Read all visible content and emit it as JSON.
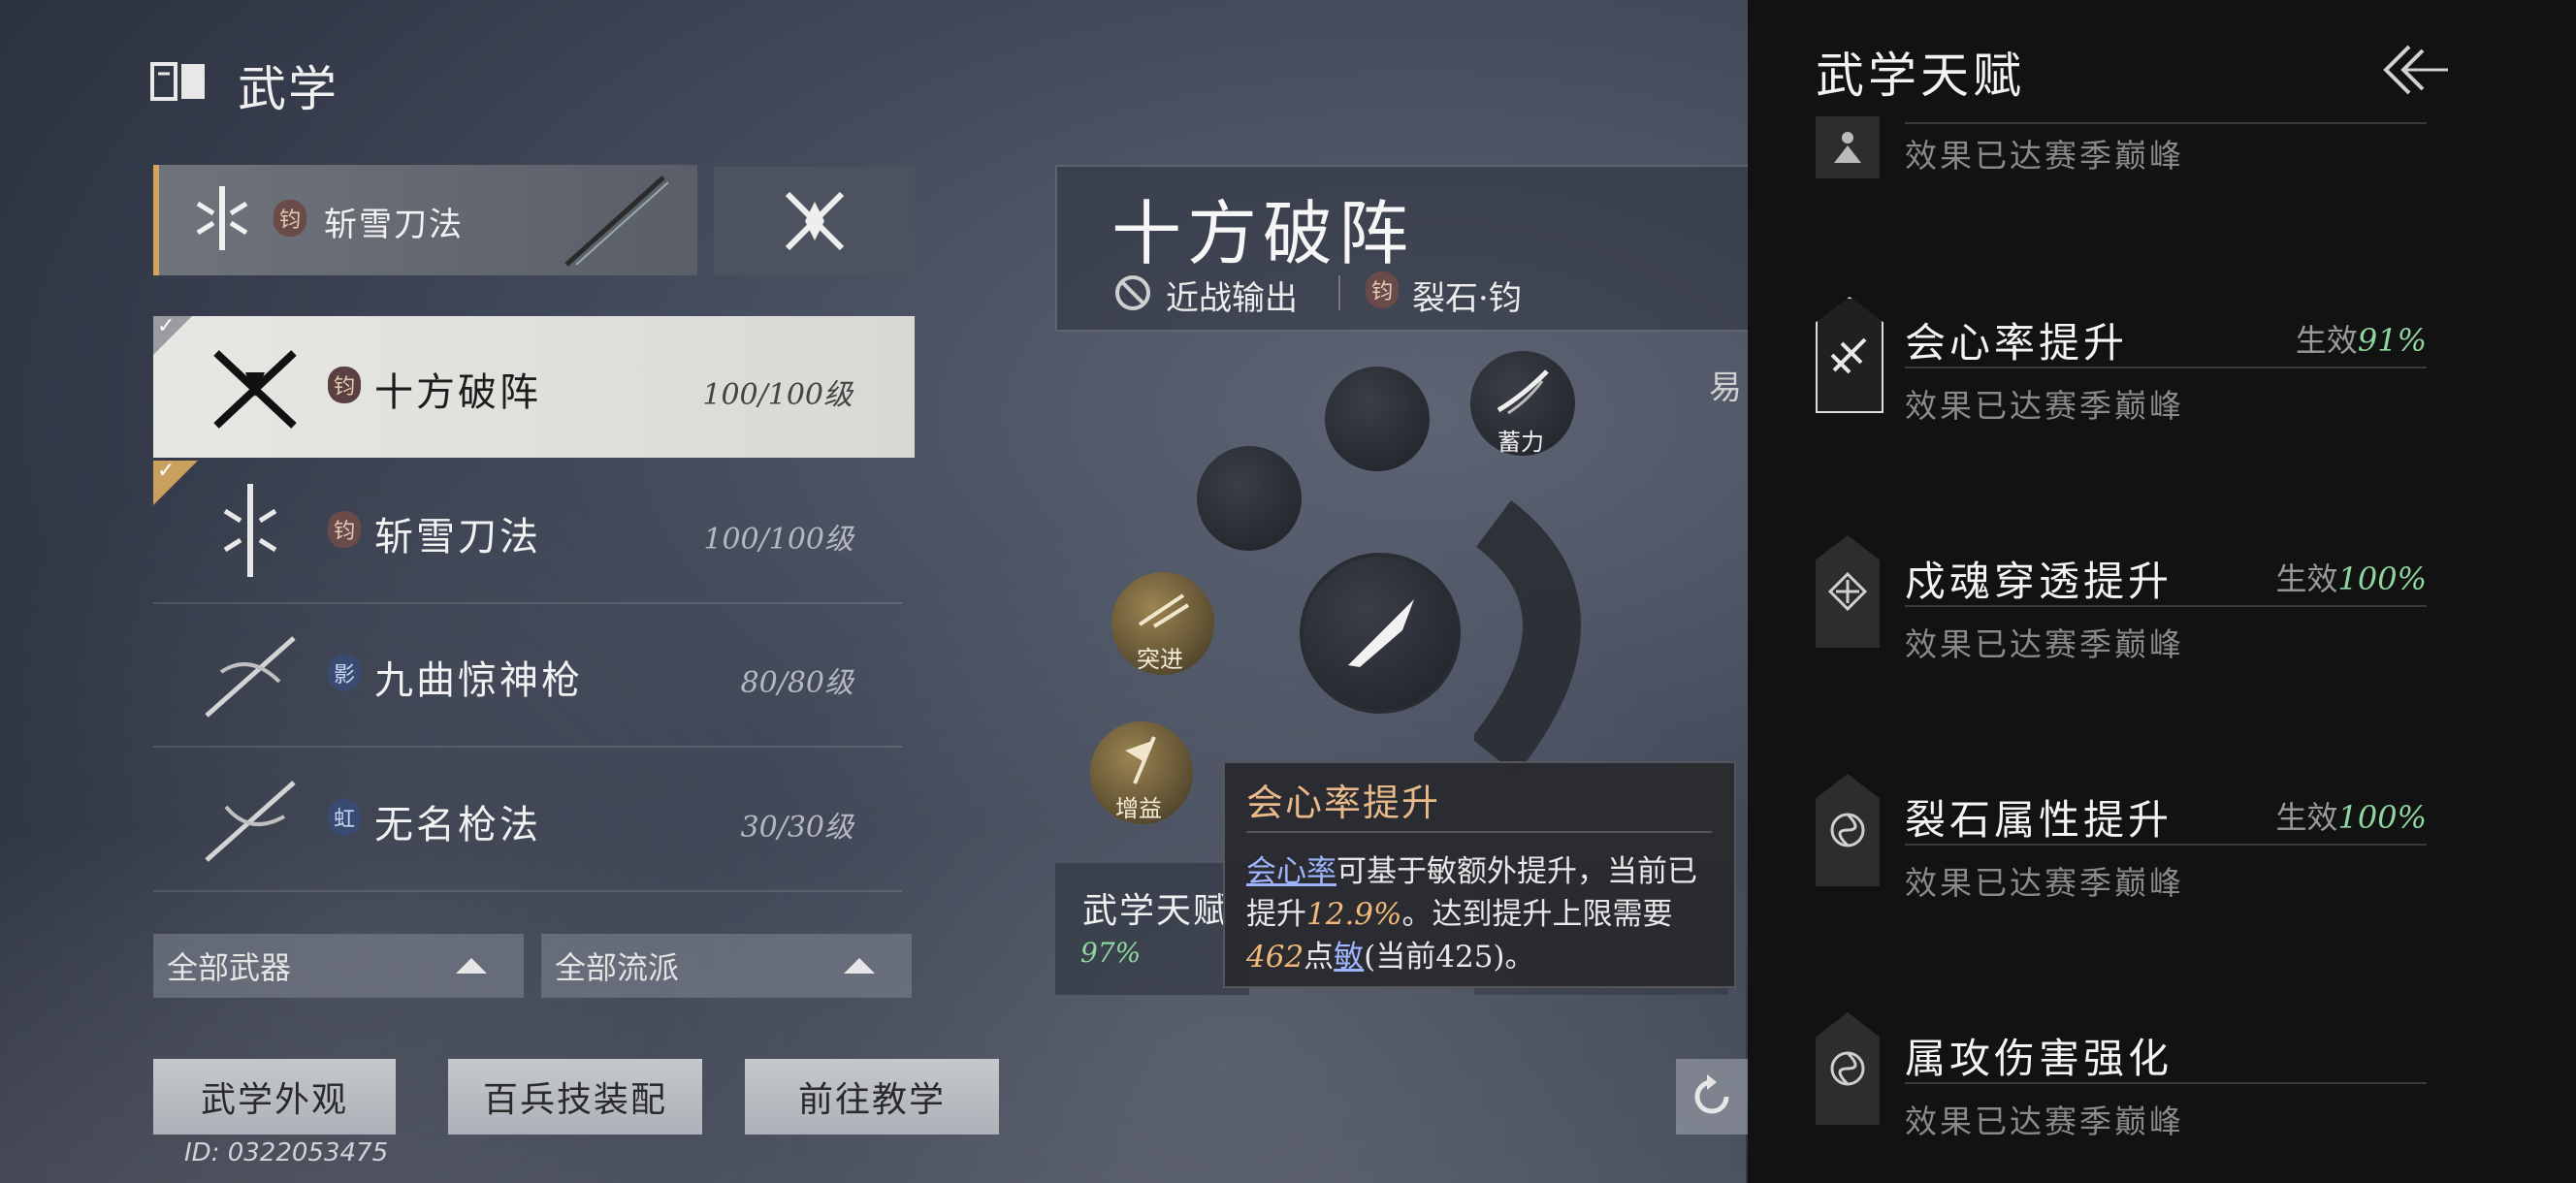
{
  "header": {
    "title": "武学"
  },
  "weapon_slot": {
    "tag": "钧",
    "name": "斩雪刀法"
  },
  "skill_list": [
    {
      "tag": "钧",
      "name": "十方破阵",
      "level": "100/100级",
      "selected": true
    },
    {
      "tag": "钧",
      "name": "斩雪刀法",
      "level": "100/100级"
    },
    {
      "tag": "影",
      "name": "九曲惊神枪",
      "level": "80/80级"
    },
    {
      "tag": "虹",
      "name": "无名枪法",
      "level": "30/30级"
    }
  ],
  "filters": {
    "weapon": "全部武器",
    "school": "全部流派"
  },
  "buttons": {
    "appearance": "武学外观",
    "loadout": "百兵技装配",
    "tutorial": "前往教学"
  },
  "user_id": "ID: 0322053475",
  "skill_detail": {
    "name": "十方破阵",
    "role": "近战输出",
    "tag": "钧",
    "attribute": "裂石·钧",
    "side_label": "易",
    "nodes": {
      "charge": "蓄力",
      "dash": "突进",
      "buff": "增益"
    }
  },
  "talent_box": {
    "label": "武学天赋",
    "value": "97%"
  },
  "tooltip": {
    "title": "会心率提升",
    "link": "会心率",
    "text1": "可基于敏额外提升，当前已提升",
    "pct": "12.9%",
    "text2": "。达到提升上限需要",
    "need": "462",
    "text3": "点",
    "link2": "敏",
    "text4": "(当前425)。"
  },
  "panel": {
    "title": "武学天赋",
    "talents": [
      {
        "name": "",
        "effect_label": "",
        "effect_pct": "",
        "desc": "效果已达赛季巅峰"
      },
      {
        "name": "会心率提升",
        "effect_label": "生效",
        "effect_pct": "91%",
        "desc": "效果已达赛季巅峰"
      },
      {
        "name": "戍魂穿透提升",
        "effect_label": "生效",
        "effect_pct": "100%",
        "desc": "效果已达赛季巅峰"
      },
      {
        "name": "裂石属性提升",
        "effect_label": "生效",
        "effect_pct": "100%",
        "desc": "效果已达赛季巅峰"
      },
      {
        "name": "属攻伤害强化",
        "effect_label": "",
        "effect_pct": "",
        "desc": "效果已达赛季巅峰"
      }
    ]
  }
}
